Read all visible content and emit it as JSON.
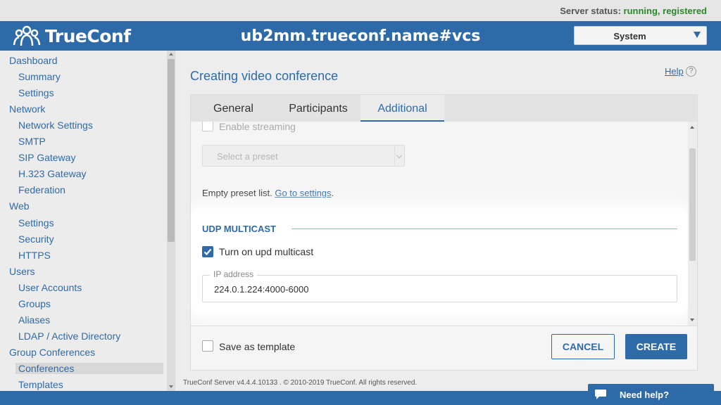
{
  "status": {
    "label": "Server status:",
    "value": "running, registered",
    "value_color": "#2a8a2a"
  },
  "header": {
    "logo_text": "TrueConf",
    "server_name": "ub2mm.trueconf.name#vcs",
    "system_select": "System",
    "brand_color": "#2f6aa8"
  },
  "sidebar": {
    "items": [
      {
        "label": "Dashboard",
        "level": "top"
      },
      {
        "label": "Summary",
        "level": "sub"
      },
      {
        "label": "Settings",
        "level": "sub"
      },
      {
        "label": "Network",
        "level": "top"
      },
      {
        "label": "Network Settings",
        "level": "sub"
      },
      {
        "label": "SMTP",
        "level": "sub"
      },
      {
        "label": "SIP Gateway",
        "level": "sub"
      },
      {
        "label": "H.323 Gateway",
        "level": "sub"
      },
      {
        "label": "Federation",
        "level": "sub"
      },
      {
        "label": "Web",
        "level": "top"
      },
      {
        "label": "Settings",
        "level": "sub"
      },
      {
        "label": "Security",
        "level": "sub"
      },
      {
        "label": "HTTPS",
        "level": "sub"
      },
      {
        "label": "Users",
        "level": "top"
      },
      {
        "label": "User Accounts",
        "level": "sub"
      },
      {
        "label": "Groups",
        "level": "sub"
      },
      {
        "label": "Aliases",
        "level": "sub"
      },
      {
        "label": "LDAP / Active Directory",
        "level": "sub"
      },
      {
        "label": "Group Conferences",
        "level": "top"
      },
      {
        "label": "Conferences",
        "level": "sub",
        "active": true
      },
      {
        "label": "Templates",
        "level": "sub"
      }
    ]
  },
  "main": {
    "title": "Creating video conference",
    "help_label": "Help",
    "help_icon_glyph": "?",
    "tabs": [
      {
        "label": "General"
      },
      {
        "label": "Participants"
      },
      {
        "label": "Additional",
        "active": true
      }
    ],
    "streaming": {
      "label": "Enable streaming",
      "checked": false,
      "preset_placeholder": "Select a preset"
    },
    "empty_preset": {
      "text": "Empty preset list.",
      "link": "Go to settings",
      "suffix": "."
    },
    "udp": {
      "section_title": "UDP MULTICAST",
      "toggle_label": "Turn on upd multicast",
      "toggle_checked": true,
      "ip_legend": "IP address",
      "ip_value": "224.0.1.224:4000-6000"
    },
    "save_template": {
      "label": "Save as template",
      "checked": false
    },
    "cancel_label": "CANCEL",
    "create_label": "CREATE"
  },
  "footer": {
    "copyright": "TrueConf Server v4.4.4.10133 . © 2010-2019 TrueConf. All rights reserved."
  },
  "need_help": {
    "label": "Need help?"
  }
}
